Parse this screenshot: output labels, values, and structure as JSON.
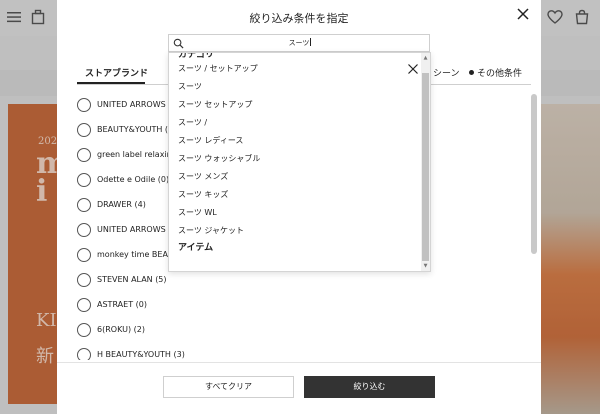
{
  "modal": {
    "title": "絞り込み条件を指定",
    "tabs": [
      {
        "label": "ストアブランド",
        "active": true
      },
      {
        "label": "シーン",
        "active": false
      },
      {
        "label": "その他条件",
        "active": false
      }
    ],
    "brands": [
      {
        "label": "UNITED ARROWS (",
        "selected": false
      },
      {
        "label": "BEAUTY&YOUTH (",
        "selected": false
      },
      {
        "label": "green label relaxing (",
        "selected": false
      },
      {
        "label": "Odette e Odile (0)",
        "selected": false
      },
      {
        "label": "DRAWER (4)",
        "selected": false
      },
      {
        "label": "UNITED ARROWS &",
        "selected": false
      },
      {
        "label": "monkey time BEAUT",
        "selected": false
      },
      {
        "label": "STEVEN ALAN (5)",
        "selected": false
      },
      {
        "label": "ASTRAET (0)",
        "selected": false
      },
      {
        "label": "6(ROKU) (2)",
        "selected": false
      },
      {
        "label": "H BEAUTY&YOUTH (3)",
        "selected": false
      }
    ],
    "footer": {
      "clear_label": "すべてクリア",
      "apply_label": "絞り込む"
    }
  },
  "search": {
    "value": "スーツ"
  },
  "suggestions": {
    "top_header": "カテゴリ",
    "items": [
      "スーツ / セットアップ",
      "スーツ",
      "スーツ セットアップ",
      "スーツ /",
      "スーツ レディース",
      "スーツ ウォッシャブル",
      "スーツ メンズ",
      "スーツ キッズ",
      "スーツ WL",
      "スーツ ジャケット"
    ],
    "bottom_header": "アイテム"
  },
  "background": {
    "banner_year": "202",
    "banner_big": "m\ni",
    "banner_bottom_latin": "KI",
    "banner_bottom_kanji": "新"
  },
  "colors": {
    "apply_button": "#333333",
    "banner": "#c0531b"
  },
  "icons": {
    "menu": "hamburger-menu-icon",
    "bag_left": "shopping-bag-icon",
    "heart": "heart-icon",
    "bag_right": "shopping-bag-icon",
    "close": "close-icon",
    "search": "search-icon",
    "clear": "clear-search-icon"
  }
}
